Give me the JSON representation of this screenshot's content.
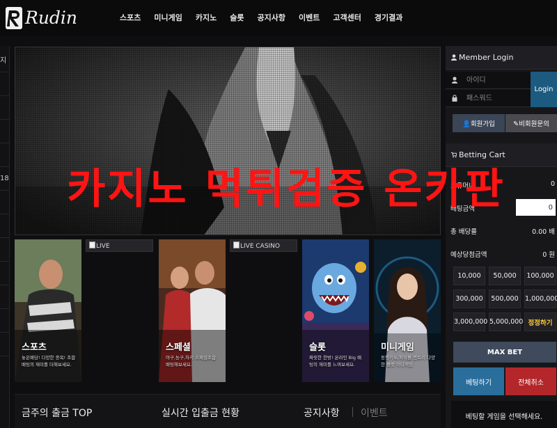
{
  "header": {
    "logo_text": "Rudin",
    "nav": [
      "스포츠",
      "미니게임",
      "카지노",
      "슬롯",
      "공지사항",
      "이벤트",
      "고객센터",
      "경기결과"
    ]
  },
  "left_rail": {
    "label_top": "지",
    "label_mid": "18"
  },
  "banner": {
    "headline": "카지노 먹튀검증 온카판"
  },
  "tiles": [
    {
      "title": "스포츠",
      "sub": "놓은배당! 다양한 종목! 조합배팅의 재미를 더해보세요."
    },
    {
      "title": "스페셜",
      "sub": "야구,농구,하키 스페셜조합 배팅해보세요."
    },
    {
      "title": "슬롯",
      "sub": "짜릿한 한방! 온라인 Big 배팅의 재미를 느껴보세요."
    },
    {
      "title": "미니게임",
      "sub": "동행키노,파워볼,엔트리 다양한 플랫 미니게임"
    }
  ],
  "broken_images": {
    "live": "LIVE",
    "live_casino": "LIVE CASINO"
  },
  "bottom": {
    "withdraw_top": "금주의 출금 TOP",
    "realtime": "실시간 입출금 현황",
    "tab_notice": "공지사항",
    "tab_event": "이벤트"
  },
  "login": {
    "title": "Member Login",
    "id_placeholder": "아이디",
    "pw_placeholder": "패스워드",
    "login_button": "Login",
    "signup_button": "회원가입",
    "guest_inquiry_button": "비회원문의"
  },
  "cart": {
    "title": "Betting Cart",
    "rows": [
      {
        "label": "보유머니",
        "value": "0"
      },
      {
        "label": "배팅금액",
        "value": ""
      },
      {
        "label": "총 배당률",
        "value": "0.00 배"
      },
      {
        "label": "예상당첨금액",
        "value": "0 원"
      }
    ],
    "amount_value": "0",
    "amounts": [
      "10,000",
      "50,000",
      "100,000",
      "300,000",
      "500,000",
      "1,000,000",
      "3,000,000",
      "5,000,000",
      "정정하기"
    ],
    "max_bet": "MAX BET",
    "bet_button": "베팅하기",
    "cancel_all_button": "전체취소",
    "notice": "베팅할 게임을 선택해세요."
  },
  "colors": {
    "headline": "#ff1414",
    "login_button": "#1d5a80",
    "bet_button": "#2a6e9c",
    "cancel_button": "#b32629",
    "max_bet": "#3f4a5c",
    "reset_amount": "#ffcc33"
  }
}
